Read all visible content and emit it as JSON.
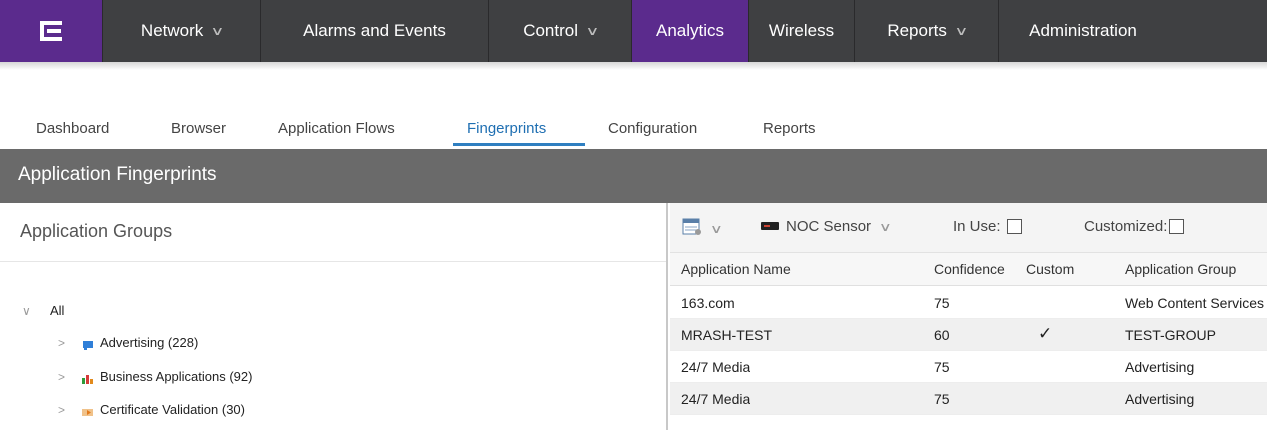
{
  "topnav": {
    "logo_icon": "extreme-logo-icon",
    "items": [
      {
        "label": "Network",
        "has_dropdown": true,
        "active": false
      },
      {
        "label": "Alarms and Events",
        "has_dropdown": false,
        "active": false
      },
      {
        "label": "Control",
        "has_dropdown": true,
        "active": false
      },
      {
        "label": "Analytics",
        "has_dropdown": false,
        "active": true
      },
      {
        "label": "Wireless",
        "has_dropdown": false,
        "active": false
      },
      {
        "label": "Reports",
        "has_dropdown": true,
        "active": false
      },
      {
        "label": "Administration",
        "has_dropdown": false,
        "active": false
      }
    ],
    "colors": {
      "bar": "#3f4042",
      "active": "#5b2b8d"
    }
  },
  "subtabs": {
    "items": [
      "Dashboard",
      "Browser",
      "Application Flows",
      "Fingerprints",
      "Configuration",
      "Reports"
    ],
    "active": "Fingerprints"
  },
  "section": {
    "title": "Application Fingerprints"
  },
  "left": {
    "header": "Application Groups",
    "tree": {
      "root": "All",
      "children": [
        {
          "label": "Advertising (228)",
          "icon": "advertising-icon"
        },
        {
          "label": "Business Applications (92)",
          "icon": "bar-chart-icon"
        },
        {
          "label": "Certificate Validation (30)",
          "icon": "certificate-icon"
        }
      ]
    }
  },
  "right": {
    "toolbar": {
      "menu_icon": "table-menu-icon",
      "sensor_icon": "sensor-icon",
      "sensor": "NOC Sensor",
      "in_use_label": "In Use:",
      "customized_label": "Customized:"
    },
    "columns": [
      "Application Name",
      "Confidence",
      "Custom",
      "Application Group"
    ],
    "rows": [
      {
        "name": "163.com",
        "confidence": "75",
        "custom": "",
        "group": "Web Content Services"
      },
      {
        "name": "MRASH-TEST",
        "confidence": "60",
        "custom": "✓",
        "group": "TEST-GROUP"
      },
      {
        "name": "24/7 Media",
        "confidence": "75",
        "custom": "",
        "group": "Advertising"
      },
      {
        "name": "24/7 Media",
        "confidence": "75",
        "custom": "",
        "group": "Advertising"
      }
    ]
  }
}
